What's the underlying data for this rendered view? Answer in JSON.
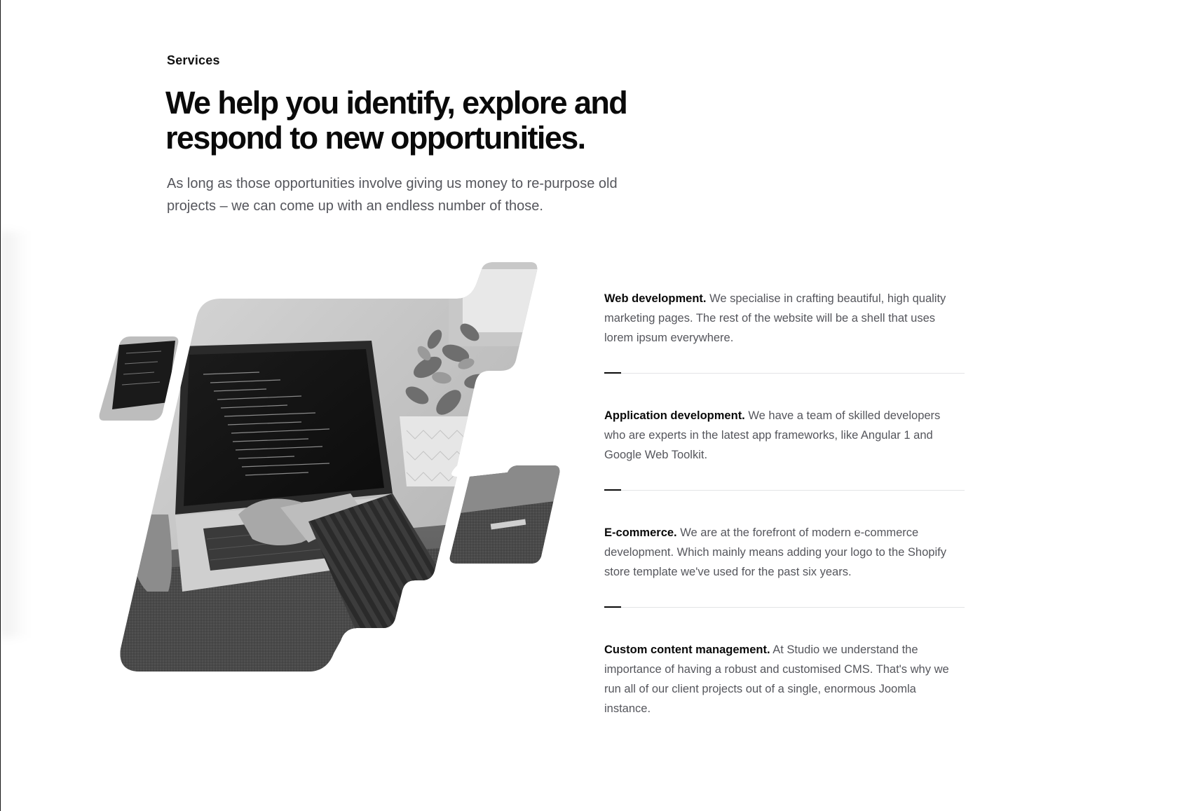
{
  "section": {
    "eyebrow": "Services",
    "headline": "We help you identify, explore and respond to new opportunities.",
    "lede": "As long as those opportunities involve giving us money to re-purpose old projects – we can come up with an endless number of those."
  },
  "image": {
    "subject": "laptop-photo",
    "palette": "grayscale"
  },
  "services": [
    {
      "title": "Web development.",
      "description": "We specialise in crafting beautiful, high quality marketing pages. The rest of the website will be a shell that uses lorem ipsum everywhere."
    },
    {
      "title": "Application development.",
      "description": "We have a team of skilled developers who are experts in the latest app frameworks, like Angular 1 and Google Web Toolkit."
    },
    {
      "title": "E-commerce.",
      "description": "We are at the forefront of modern e-commerce development. Which mainly means adding your logo to the Shopify store template we've used for the past six years."
    },
    {
      "title": "Custom content management.",
      "description": "At Studio we understand the importance of having a robust and customised CMS. That's why we run all of our client projects out of a single, enormous Joomla instance."
    }
  ],
  "colors": {
    "text_primary": "#0a0a0a",
    "text_secondary": "#55565c",
    "divider": "#e3e4e6",
    "background": "#ffffff"
  }
}
